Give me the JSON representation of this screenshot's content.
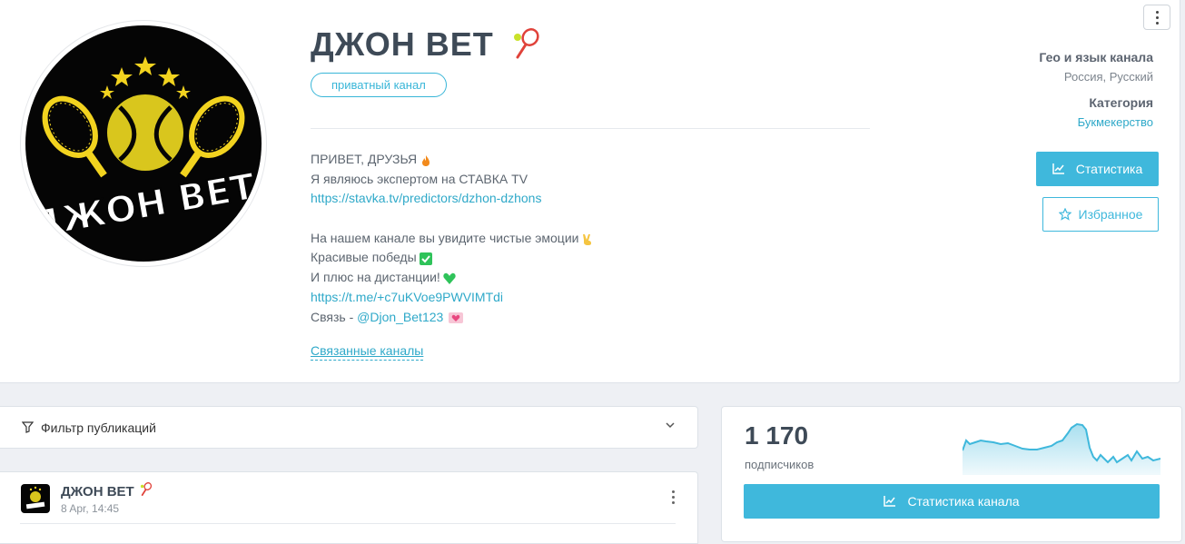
{
  "channel": {
    "title": "ДЖОН ВЕТ",
    "badge": "приватный канал",
    "avatar_text": "ДЖОН ВЕТ",
    "description": {
      "line1": "ПРИВЕТ, ДРУЗЬЯ",
      "line2": "Я являюсь экспертом на СТАВКА TV",
      "link1": "https://stavka.tv/predictors/dzhon-dzhons",
      "line3": "На нашем канале вы увидите чистые эмоции",
      "line4": "Красивые победы",
      "line5": "И плюс на дистанции!",
      "link2": "https://t.me/+c7uKVoe9PWVIMTdi",
      "contact_prefix": "Связь - ",
      "contact_handle": "@Djon_Bet123"
    },
    "related_channels": "Связанные каналы"
  },
  "meta": {
    "geo_label": "Гео и язык канала",
    "geo_value": "Россия, Русский",
    "category_label": "Категория",
    "category_value": "Букмекерство"
  },
  "actions": {
    "stats": "Статистика",
    "favorite": "Избранное"
  },
  "filter": {
    "label": "Фильтр публикаций"
  },
  "post": {
    "author": "ДЖОН ВЕТ",
    "date": "8 Apr, 14:45"
  },
  "subscribers": {
    "count": "1 170",
    "label": "подписчиков",
    "button": "Статистика канала"
  },
  "colors": {
    "accent": "#3fb8dc",
    "link": "#2fa9c9",
    "title": "#3e4a57"
  },
  "icons": {
    "stats": "line-chart-icon",
    "favorite": "star-icon",
    "filter": "funnel-icon",
    "chevron": "chevron-down-icon",
    "menu": "vertical-dots-icon"
  }
}
